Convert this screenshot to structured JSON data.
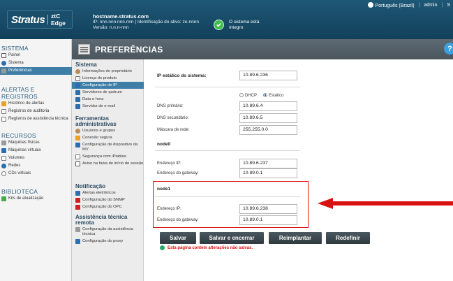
{
  "header": {
    "logo_main": "Stratus",
    "logo_sub": "ztC Edge",
    "hostname": "hostname.stratus.com",
    "ip_line": "IP: nnn.nnn.nnn.nnn | Identificação do ativo: ze-nnnn",
    "version_line": "Versão: n.n.n-nnn",
    "status_text_1": "O sistema está",
    "status_text_2": "íntegro",
    "language": "Português (Brazil)",
    "user": "admin",
    "nav_extra": "S"
  },
  "sidebar": {
    "sections": [
      {
        "title": "SISTEMA",
        "items": [
          {
            "label": "Painel",
            "icon": "dashboard-icon"
          },
          {
            "label": "Sistema",
            "icon": "system-icon"
          },
          {
            "label": "Preferências",
            "icon": "preferences-icon",
            "active": true
          }
        ]
      },
      {
        "title": "ALERTAS E REGISTROS",
        "items": [
          {
            "label": "Histórico de alertas",
            "icon": "alert-icon"
          },
          {
            "label": "Registros de auditoria",
            "icon": "audit-icon"
          },
          {
            "label": "Registros de assistência técnica",
            "icon": "support-log-icon"
          }
        ]
      },
      {
        "title": "RECURSOS",
        "items": [
          {
            "label": "Máquinas físicas",
            "icon": "physical-machine-icon"
          },
          {
            "label": "Máquinas virtuais",
            "icon": "virtual-machine-icon"
          },
          {
            "label": "Volumes",
            "icon": "volume-icon"
          },
          {
            "label": "Redes",
            "icon": "network-icon"
          },
          {
            "label": "CDs virtuais",
            "icon": "virtual-cd-icon"
          }
        ]
      },
      {
        "title": "BIBLIOTECA",
        "items": [
          {
            "label": "Kits de atualização",
            "icon": "upgrade-kit-icon"
          }
        ]
      }
    ]
  },
  "page": {
    "title": "PREFERÊNCIAS",
    "help": "?"
  },
  "menu": {
    "sistema_title": "Sistema",
    "sistema": [
      "Informações do proprietário",
      "Licença do produto",
      "Configuração de IP",
      "Servidores de quórum",
      "Data e hora",
      "Servidor de e-mail"
    ],
    "ferramentas_title_1": "Ferramentas",
    "ferramentas_title_2": "administrativas",
    "ferramentas": [
      "Usuários e grupos",
      "Conexão segura",
      "Configuração de dispositivo da MV",
      "Segurança com iPtables",
      "Aviso na faixa de início de sessão"
    ],
    "notificacao_title": "Notificação",
    "notificacao": [
      "Alertas eletrônicos",
      "Configuração do SNMP",
      "Configuração do OPC"
    ],
    "assistencia_title": "Assistência técnica remota",
    "assistencia": [
      "Configuração da assistência técnica",
      "Configuração do proxy"
    ]
  },
  "form": {
    "system_ip_label": "IP estático do sistema:",
    "system_ip": "10.89.6.236",
    "dhcp_label": "DHCP",
    "static_label": "Estático",
    "dns1_label": "DNS primário:",
    "dns1": "10.89.6.4",
    "dns2_label": "DNS secundário:",
    "dns2": "10.89.6.5",
    "mask_label": "Máscara de rede:",
    "mask": "255.255.0.0",
    "node0_title": "node0",
    "node0_ip_label": "Endereço IP:",
    "node0_ip": "10.89.6.237",
    "node0_gw_label": "Endereço do gateway:",
    "node0_gw": "10.89.0.1",
    "node1_title": "node1",
    "node1_ip_label": "Endereço IP:",
    "node1_ip": "10.89.6.238",
    "node1_gw_label": "Endereço do gateway:",
    "node1_gw": "10.89.0.1"
  },
  "buttons": {
    "save": "Salvar",
    "save_close": "Salvar e encerrar",
    "redeploy": "Reimplantar",
    "reset": "Redefinir"
  },
  "warning": "Esta página contém alterações não salvas.",
  "colors": {
    "header_bg": "#1e5877",
    "active_item": "#3f7ea6",
    "highlight_red": "#d11111",
    "button_bg": "#3a454c"
  }
}
